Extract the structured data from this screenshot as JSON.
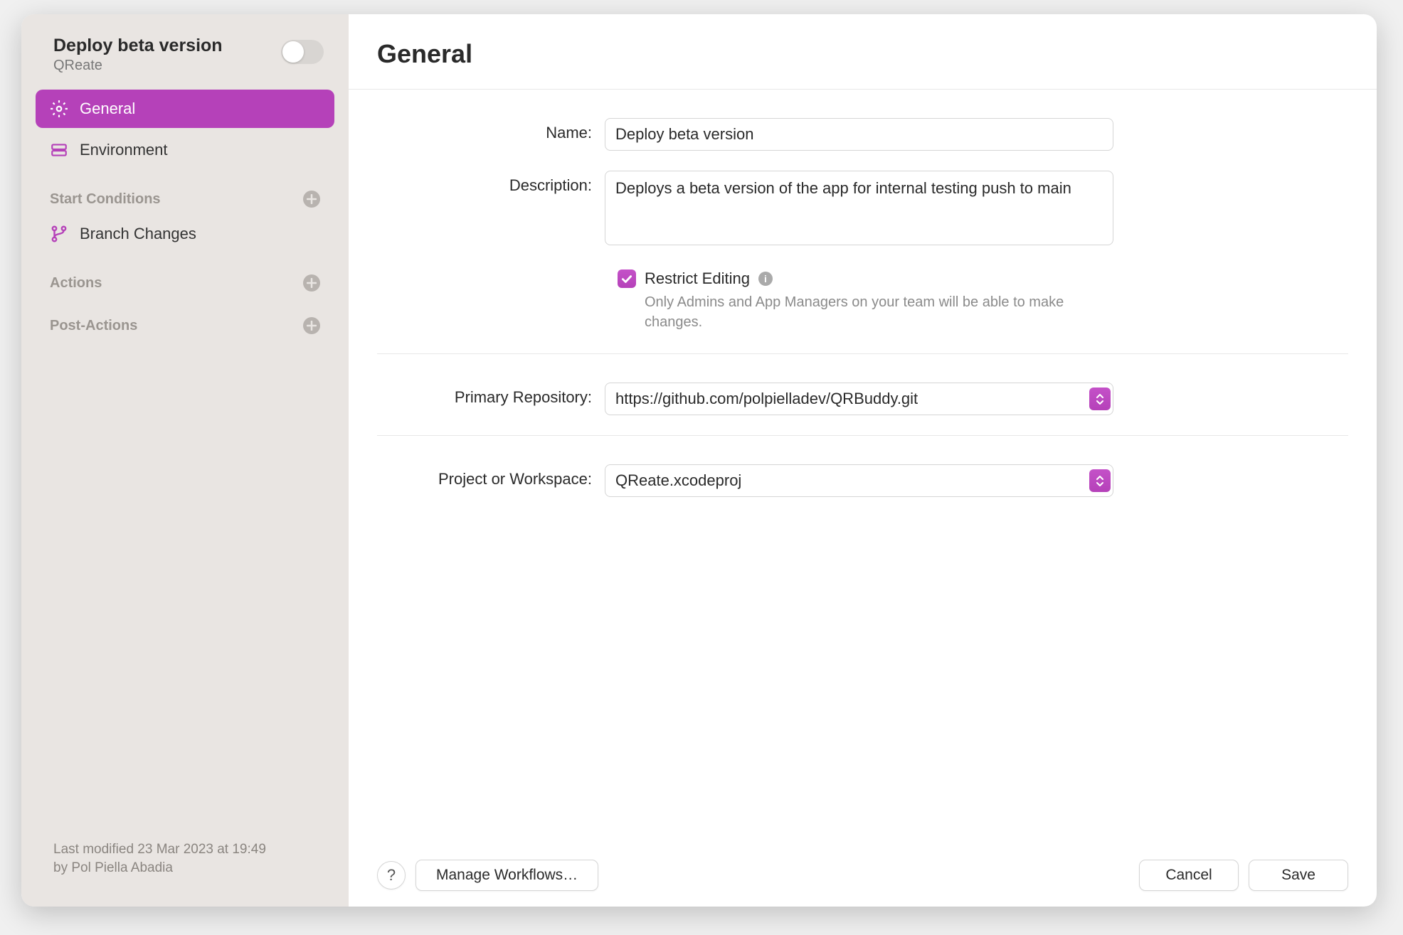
{
  "sidebar": {
    "title": "Deploy beta version",
    "subtitle": "QReate",
    "nav": {
      "general": "General",
      "environment": "Environment"
    },
    "sections": {
      "start_conditions": "Start Conditions",
      "branch_changes": "Branch Changes",
      "actions": "Actions",
      "post_actions": "Post-Actions"
    },
    "footer_line1": "Last modified 23 Mar 2023 at 19:49",
    "footer_line2": "by Pol Piella Abadia"
  },
  "main": {
    "title": "General",
    "name_label": "Name:",
    "name_value": "Deploy beta version",
    "description_label": "Description:",
    "description_value": "Deploys a beta version of the app for internal testing push to main",
    "restrict_label": "Restrict Editing",
    "restrict_hint": "Only Admins and App Managers on your team will be able to make changes.",
    "repo_label": "Primary Repository:",
    "repo_value": "https://github.com/polpielladev/QRBuddy.git",
    "project_label": "Project or Workspace:",
    "project_value": "QReate.xcodeproj"
  },
  "footer": {
    "help": "?",
    "manage": "Manage Workflows…",
    "cancel": "Cancel",
    "save": "Save"
  }
}
